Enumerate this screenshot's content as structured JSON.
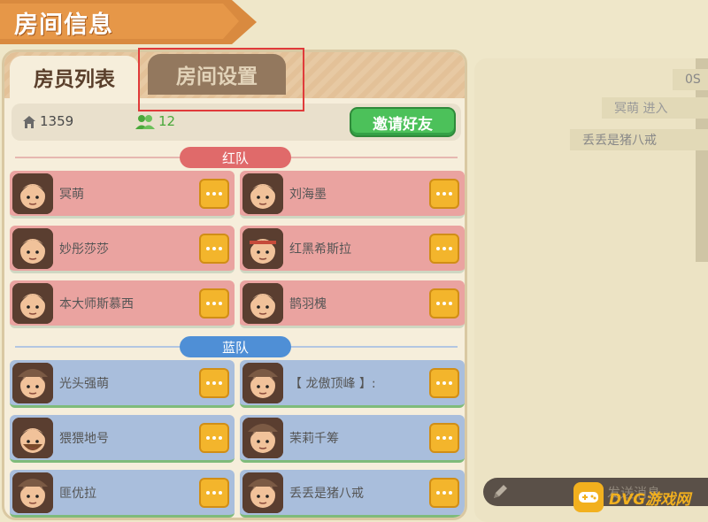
{
  "header": {
    "title": "房间信息"
  },
  "tabs": [
    {
      "label": "房员列表",
      "active": true
    },
    {
      "label": "房间设置",
      "active": false
    }
  ],
  "room": {
    "room_id": "1359",
    "member_count": "12",
    "invite_label": "邀请好友"
  },
  "teams": {
    "red": {
      "label": "红队",
      "color": "#e06a6a",
      "players": [
        {
          "name": "冥萌",
          "avatar": "dark-hair-girl"
        },
        {
          "name": "刘海墨",
          "avatar": "dark-hair-boy"
        },
        {
          "name": "妙彤莎莎",
          "avatar": "dark-hair-girl"
        },
        {
          "name": "红黑希斯拉",
          "avatar": "headband-boy"
        },
        {
          "name": "本大师斯慕西",
          "avatar": "dark-hair-girl"
        },
        {
          "name": "鹊羽槐",
          "avatar": "dark-hair-boy"
        }
      ]
    },
    "blue": {
      "label": "蓝队",
      "color": "#4f8fd6",
      "players": [
        {
          "name": "光头强萌",
          "avatar": "hat-boy"
        },
        {
          "name": "【 龙傲顶峰 】:",
          "avatar": "hat-boy"
        },
        {
          "name": "猥猥地号",
          "avatar": "bearded-man"
        },
        {
          "name": "茉莉千筹",
          "avatar": "hat-boy"
        },
        {
          "name": "匪优拉",
          "avatar": "hat-boy"
        },
        {
          "name": "丢丢是猪八戒",
          "avatar": "cowboy-hat"
        }
      ]
    }
  },
  "chat": {
    "lines": [
      "0S",
      "冥萌 进入",
      "丢丢是猪八戒"
    ],
    "input_text": "发送消息"
  },
  "watermark": {
    "text": "DVG游戏网"
  },
  "icons": {
    "home": "home-icon",
    "people": "people-icon",
    "menu": "more-dots-icon",
    "pencil": "pencil-icon",
    "gamepad": "gamepad-icon"
  }
}
